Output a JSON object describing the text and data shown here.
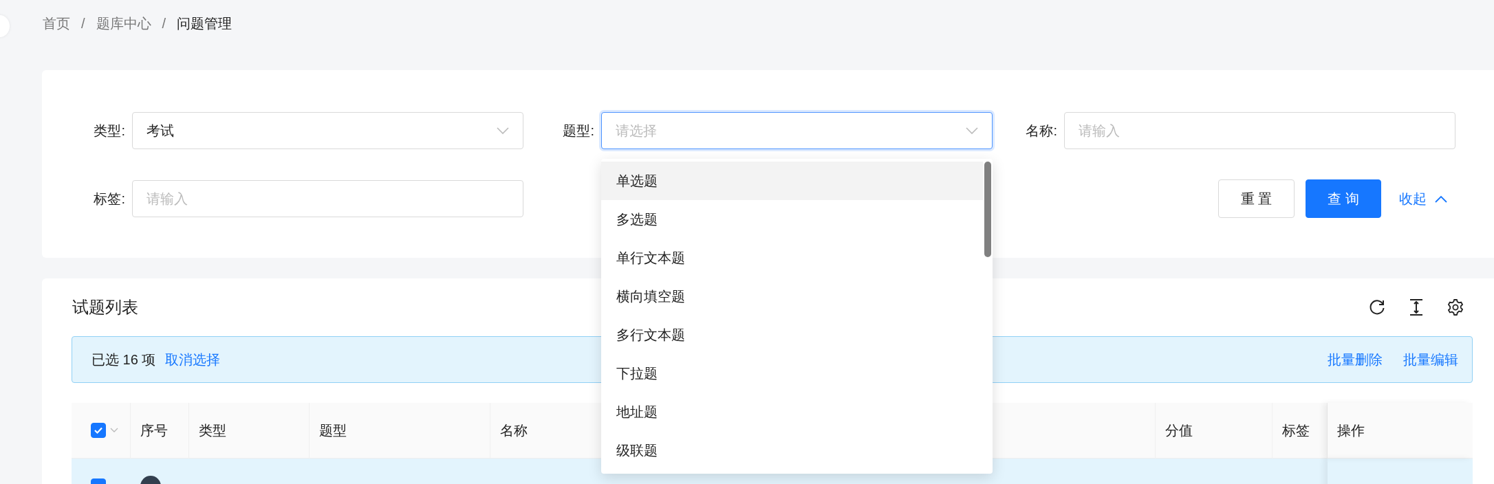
{
  "breadcrumb": [
    {
      "kind": "link",
      "text": "首页"
    },
    {
      "kind": "separator",
      "text": "/"
    },
    {
      "kind": "link",
      "text": "题库中心"
    },
    {
      "kind": "separator",
      "text": "/"
    },
    {
      "kind": "current",
      "text": "问题管理"
    }
  ],
  "filters": [
    {
      "kind": "select",
      "label": "类型:",
      "value": "考试",
      "focused": false
    },
    {
      "kind": "select",
      "label": "题型:",
      "placeholder": "请选择",
      "focused": true
    },
    {
      "kind": "input",
      "label": "名称:",
      "placeholder": "请输入",
      "focused": false
    },
    {
      "kind": "input",
      "label": "标签:",
      "placeholder": "请输入",
      "focused": false
    }
  ],
  "filter_buttons": [
    {
      "kind": "default",
      "label": "重 置"
    },
    {
      "kind": "primary",
      "label": "查 询"
    }
  ],
  "collapse_link": {
    "label": "收起",
    "expanded": true
  },
  "dropdown": {
    "options": [
      {
        "label": "单选题",
        "highlighted": true
      },
      {
        "label": "多选题",
        "highlighted": false
      },
      {
        "label": "单行文本题",
        "highlighted": false
      },
      {
        "label": "横向填空题",
        "highlighted": false
      },
      {
        "label": "多行文本题",
        "highlighted": false
      },
      {
        "label": "下拉题",
        "highlighted": false
      },
      {
        "label": "地址题",
        "highlighted": false
      },
      {
        "label": "级联题",
        "highlighted": false
      }
    ]
  },
  "table": {
    "title": "试题列表",
    "selection_bar": {
      "summary": "已选 16 项",
      "clear_link": "取消选择",
      "actions": [
        "批量删除",
        "批量编辑"
      ]
    },
    "all_checked": true,
    "columns": [
      {
        "label": "序号"
      },
      {
        "label": "类型"
      },
      {
        "label": "题型"
      },
      {
        "label": "名称"
      },
      {
        "label": "分值"
      },
      {
        "label": "标签"
      },
      {
        "label": "操作"
      }
    ],
    "rows": [
      {
        "checked": true,
        "selected": true
      }
    ]
  }
}
